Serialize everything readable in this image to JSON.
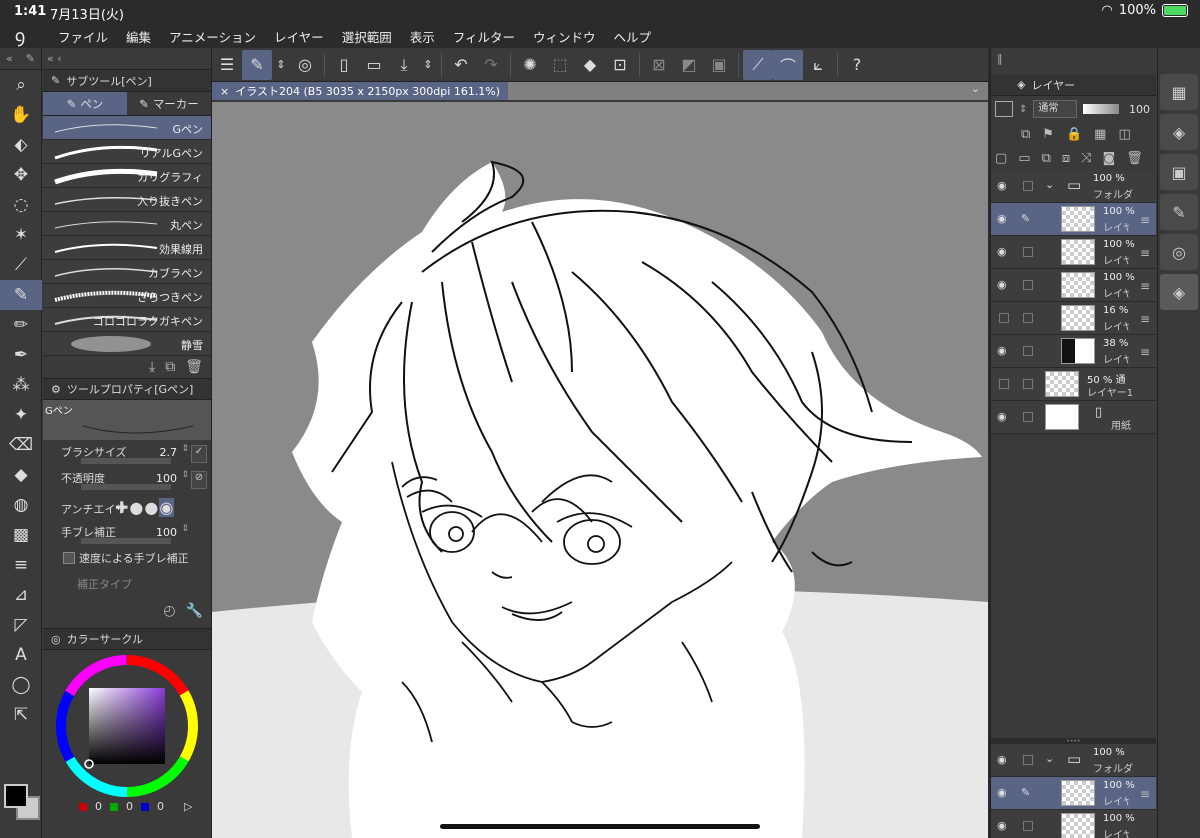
{
  "status": {
    "time": "1:41",
    "date": "7月13日(火)",
    "battery": "100%"
  },
  "menu": [
    "ファイル",
    "編集",
    "アニメーション",
    "レイヤー",
    "選択範囲",
    "表示",
    "フィルター",
    "ウィンドウ",
    "ヘルプ"
  ],
  "subtool": {
    "title": "サブツール[ペン]",
    "tabs": [
      "ペン",
      "マーカー"
    ],
    "brushes": [
      "Gペン",
      "リアルGペン",
      "カリグラフィ",
      "入り抜きペン",
      "丸ペン",
      "効果線用",
      "カブラペン",
      "ざらつきペン",
      "ゴロゴロラクガキペン",
      "静雪"
    ]
  },
  "toolprop": {
    "title": "ツールプロパティ[Gペン]",
    "brush_name": "Gペン",
    "size_label": "ブラシサイズ",
    "size_value": "2.7",
    "opacity_label": "不透明度",
    "opacity_value": "100",
    "aa_label": "アンチエイリ",
    "stab_label": "手ブレ補正",
    "stab_value": "100",
    "speed_label": "速度による手ブレ補正",
    "type_label": "補正タイプ"
  },
  "color": {
    "title": "カラーサークル",
    "r": "0",
    "g": "0",
    "b": "0"
  },
  "canvas": {
    "tab_label": "イラスト204 (B5 3035 x 2150px 300dpi 161.1%)"
  },
  "layers": {
    "title": "レイヤー",
    "blend": "通常",
    "opacity": "100",
    "rows": [
      {
        "pct": "100 %",
        "name": "フォルダ"
      },
      {
        "pct": "100 %",
        "name": "レイヤー"
      },
      {
        "pct": "100 %",
        "name": "レイヤー"
      },
      {
        "pct": "100 %",
        "name": "レイヤー"
      },
      {
        "pct": "16 %",
        "name": "レイヤー"
      },
      {
        "pct": "38 %",
        "name": "レイヤー"
      },
      {
        "pct": "50 % 通",
        "name": "レイヤー1"
      },
      {
        "pct": "",
        "name": "用紙"
      }
    ],
    "bottom_rows": [
      {
        "pct": "100 %",
        "name": "フォルダ"
      },
      {
        "pct": "100 %",
        "name": "レイヤー"
      },
      {
        "pct": "100 %",
        "name": "レイヤー"
      }
    ]
  }
}
